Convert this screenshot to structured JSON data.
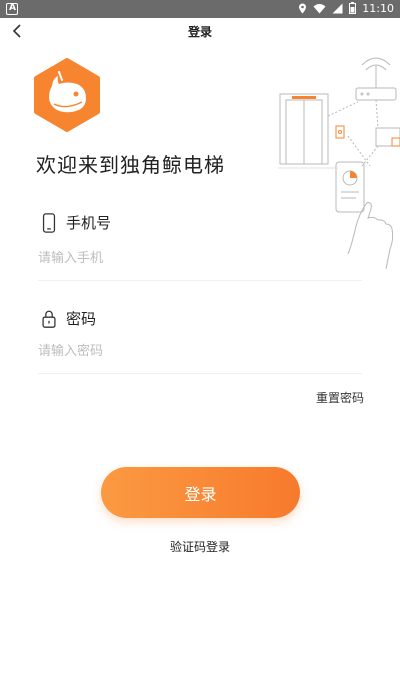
{
  "status_bar": {
    "time": "11:10"
  },
  "nav": {
    "title": "登录"
  },
  "welcome": "欢迎来到独角鲸电梯",
  "phone": {
    "label": "手机号",
    "placeholder": "请输入手机",
    "value": ""
  },
  "password": {
    "label": "密码",
    "placeholder": "请输入密码",
    "value": ""
  },
  "reset_label": "重置密码",
  "login_label": "登录",
  "sms_login_label": "验证码登录",
  "colors": {
    "accent": "#f7852f",
    "accent_light": "#fb9a42",
    "status_bar": "#6b6b6b"
  }
}
